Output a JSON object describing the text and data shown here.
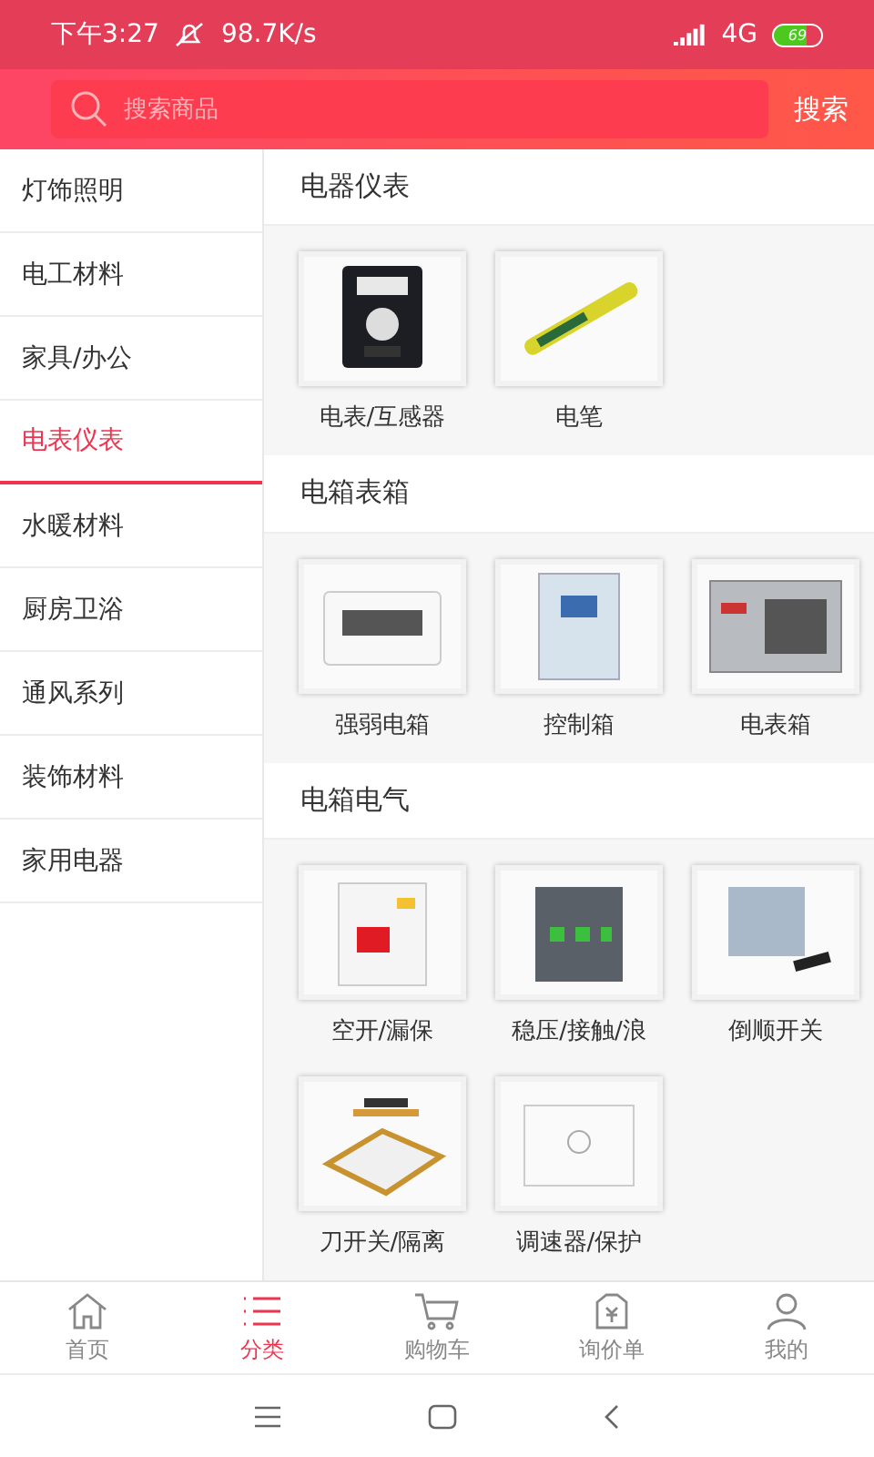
{
  "status_bar": {
    "time": "下午3:27",
    "speed": "98.7K/s",
    "network": "4G",
    "battery": "69"
  },
  "search": {
    "placeholder": "搜索商品",
    "button": "搜索"
  },
  "sidebar": {
    "items": [
      {
        "label": "灯饰照明",
        "selected": false
      },
      {
        "label": "电工材料",
        "selected": false
      },
      {
        "label": "家具/办公",
        "selected": false
      },
      {
        "label": "电表仪表",
        "selected": true
      },
      {
        "label": "水暖材料",
        "selected": false
      },
      {
        "label": "厨房卫浴",
        "selected": false
      },
      {
        "label": "通风系列",
        "selected": false
      },
      {
        "label": "装饰材料",
        "selected": false
      },
      {
        "label": "家用电器",
        "selected": false
      }
    ]
  },
  "sections": [
    {
      "title": "电器仪表",
      "products": [
        {
          "name": "电表/互感器",
          "kind": "meter"
        },
        {
          "name": "电笔",
          "kind": "pen"
        }
      ]
    },
    {
      "title": "电箱表箱",
      "products": [
        {
          "name": "强弱电箱",
          "kind": "panel"
        },
        {
          "name": "控制箱",
          "kind": "cabinet"
        },
        {
          "name": "电表箱",
          "kind": "steelbox"
        }
      ]
    },
    {
      "title": "电箱电气",
      "products": [
        {
          "name": "空开/漏保",
          "kind": "breaker"
        },
        {
          "name": "稳压/接触/浪",
          "kind": "contactor"
        },
        {
          "name": "倒顺开关",
          "kind": "switchbox"
        },
        {
          "name": "刀开关/隔离",
          "kind": "knife"
        },
        {
          "name": "调速器/保护",
          "kind": "plate"
        }
      ]
    }
  ],
  "tab_bar": [
    {
      "label": "首页",
      "kind": "home",
      "selected": false
    },
    {
      "label": "分类",
      "kind": "list",
      "selected": true
    },
    {
      "label": "购物车",
      "kind": "cart",
      "selected": false
    },
    {
      "label": "询价单",
      "kind": "tag",
      "selected": false
    },
    {
      "label": "我的",
      "kind": "user",
      "selected": false
    }
  ]
}
